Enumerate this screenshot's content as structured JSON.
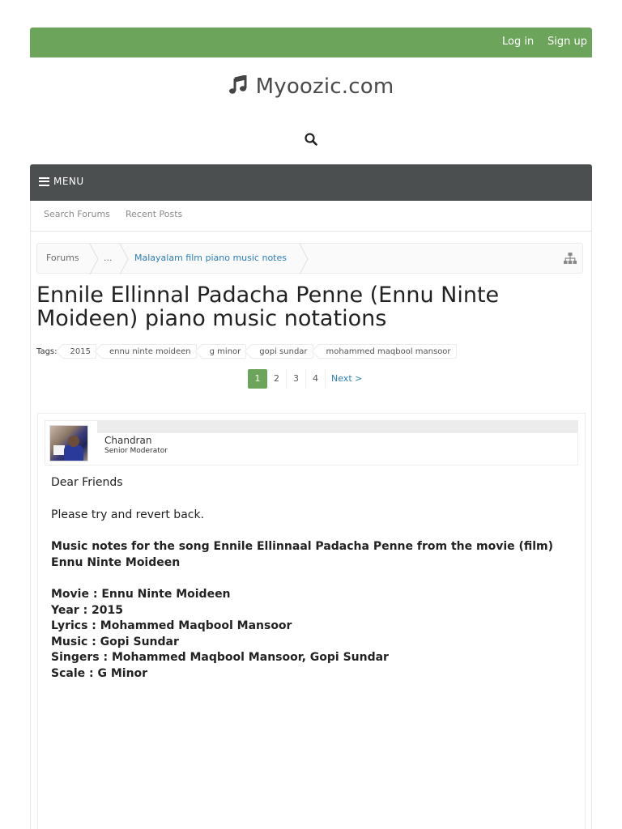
{
  "header": {
    "login": "Log in",
    "signup": "Sign up",
    "site_name": "Myoozic.com",
    "icons": {
      "logo": "music-note-icon",
      "search": "search-icon"
    }
  },
  "nav": {
    "menu_label": "MENU",
    "subnav": [
      "Search Forums",
      "Recent Posts"
    ]
  },
  "breadcrumb": {
    "items": [
      "Forums",
      "...",
      "Malayalam film piano music notes"
    ]
  },
  "thread": {
    "title": "Ennile Ellinnal Padacha Penne (Ennu Ninte Moideen) piano music notations",
    "tags_label": "Tags:",
    "tags": [
      "2015",
      "ennu ninte moideen",
      "g minor",
      "gopi sundar",
      "mohammed maqbool mansoor"
    ]
  },
  "pagination": {
    "pages": [
      "1",
      "2",
      "3",
      "4"
    ],
    "current": "1",
    "next": "Next >"
  },
  "post": {
    "author": "Chandran",
    "role": "Senior Moderator",
    "greeting": "Dear Friends",
    "line2": "Please try and revert back.",
    "headline": "Music notes for the song Ennile Ellinnaal Padacha Penne from the movie (film) Ennu Ninte Moideen",
    "details": [
      "Movie : Ennu Ninte Moideen",
      "Year : 2015",
      "Lyrics : Mohammed Maqbool Mansoor",
      "Music : Gopi Sundar",
      "Singers : Mohammed Maqbool Mansoor, Gopi Sundar",
      "Scale : G Minor"
    ]
  },
  "colors": {
    "topbar": "#6ca45c",
    "menubar": "#4c4f50",
    "link": "#2c7fb8"
  }
}
